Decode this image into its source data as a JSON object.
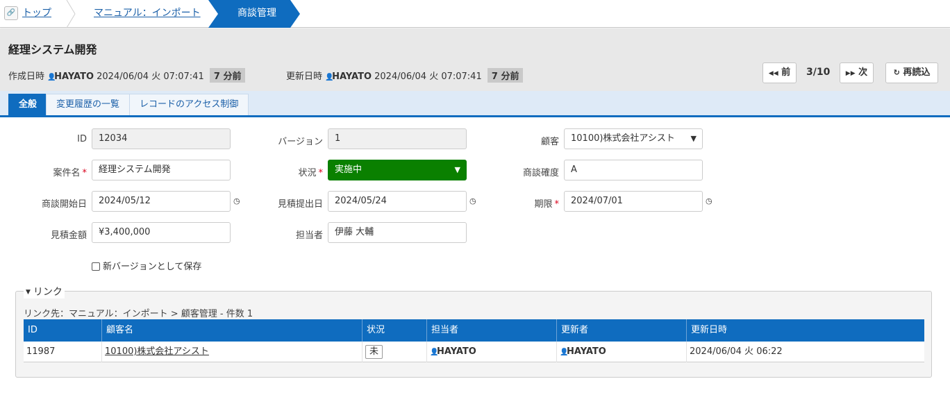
{
  "breadcrumb": {
    "items": [
      "トップ",
      "マニュアル：インポート"
    ],
    "current": "商談管理"
  },
  "header": {
    "title": "経理システム開発",
    "created": {
      "label": "作成日時",
      "user": "HAYATO",
      "datetime": "2024/06/04 火 07:07:41",
      "ago": "7 分前"
    },
    "updated": {
      "label": "更新日時",
      "user": "HAYATO",
      "datetime": "2024/06/04 火 07:07:41",
      "ago": "7 分前"
    },
    "prev_label": "前",
    "next_label": "次",
    "pager": "3/10",
    "reload_label": "再読込"
  },
  "tabs": [
    "全般",
    "変更履歴の一覧",
    "レコードのアクセス制御"
  ],
  "form": {
    "id": {
      "label": "ID",
      "value": "12034"
    },
    "version": {
      "label": "バージョン",
      "value": "1"
    },
    "customer": {
      "label": "顧客",
      "value": "10100)株式会社アシスト"
    },
    "name": {
      "label": "案件名",
      "value": "経理システム開発"
    },
    "status": {
      "label": "状況",
      "value": "実施中"
    },
    "probability": {
      "label": "商談確度",
      "value": "A"
    },
    "start_date": {
      "label": "商談開始日",
      "value": "2024/05/12"
    },
    "estimate_date": {
      "label": "見積提出日",
      "value": "2024/05/24"
    },
    "deadline": {
      "label": "期限",
      "value": "2024/07/01"
    },
    "amount": {
      "label": "見積金額",
      "value": "¥3,400,000"
    },
    "owner": {
      "label": "担当者",
      "value": "伊藤 大輔"
    },
    "save_new_version_label": "新バージョンとして保存"
  },
  "links": {
    "legend": "リンク",
    "path": "リンク先：マニュアル：インポート > 顧客管理 - 件数 1",
    "columns": [
      "ID",
      "顧客名",
      "状況",
      "担当者",
      "更新者",
      "更新日時"
    ],
    "rows": [
      {
        "id": "11987",
        "customer": "10100)株式会社アシスト",
        "status": "未",
        "owner": "HAYATO",
        "updater": "HAYATO",
        "updated_at": "2024/06/04 火 06:22"
      }
    ]
  },
  "colors": {
    "accent": "#0f6cbf",
    "status_green": "#0a8000",
    "required": "#d9001b"
  }
}
